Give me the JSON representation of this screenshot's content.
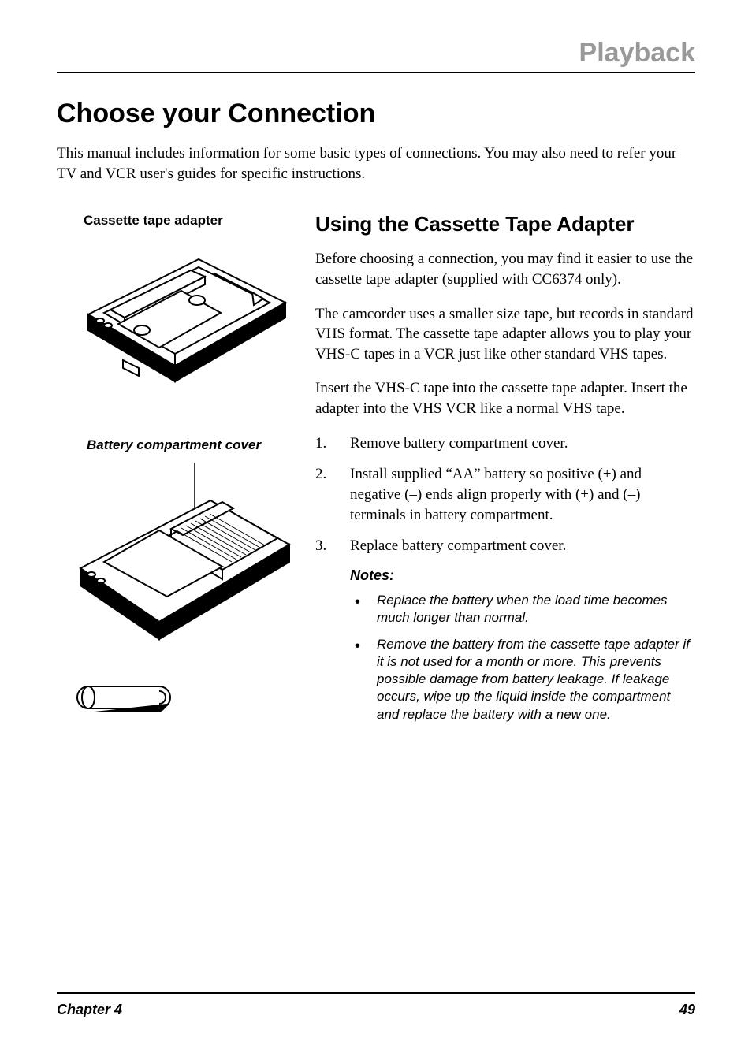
{
  "header": {
    "section": "Playback"
  },
  "main": {
    "heading": "Choose your Connection",
    "intro": "This manual includes information for some basic types of connections. You may also need to refer your TV and VCR user's guides for specific instructions."
  },
  "figures": {
    "fig1_label": "Cassette tape adapter",
    "fig2_label": "Battery compartment cover"
  },
  "subsection": {
    "heading": "Using the Cassette Tape Adapter",
    "para1": "Before choosing a connection, you may find it easier to use the cassette tape adapter (supplied with CC6374 only).",
    "para2": "The camcorder uses a smaller size tape, but records in standard VHS format. The cassette tape adapter allows you to play your VHS-C tapes in a VCR just like other standard VHS tapes.",
    "para3": "Insert the VHS-C tape into the cassette tape adapter. Insert the adapter into the VHS VCR like a normal VHS tape.",
    "steps": [
      "Remove battery compartment cover.",
      "Install supplied “AA” battery so positive (+) and negative (–) ends align properly with (+) and (–) terminals in battery compartment.",
      "Replace battery compartment cover."
    ],
    "notes_heading": "Notes:",
    "notes": [
      "Replace the battery when the load time becomes much longer than normal.",
      "Remove the battery from the cassette tape adapter if it is not used for a month or more. This prevents possible damage from battery leakage. If leakage occurs, wipe up the liquid inside the compartment and replace the battery with a new one."
    ]
  },
  "footer": {
    "chapter": "Chapter 4",
    "page": "49"
  }
}
